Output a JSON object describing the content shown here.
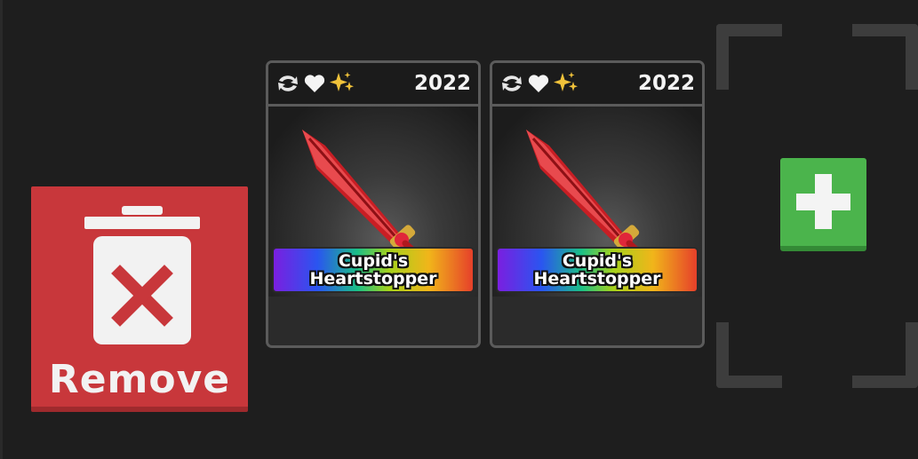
{
  "remove_button": {
    "label": "Remove",
    "icon": "trash-x-icon",
    "color": "#c8373b"
  },
  "cards": [
    {
      "badges": [
        "swap-icon",
        "heart-icon",
        "sparkles-icon"
      ],
      "year": "2022",
      "item_name_line1": "Cupid's",
      "item_name_line2": "Heartstopper",
      "rarity_colors": [
        "#7a1fe0",
        "#2a55f0",
        "#1bbf86",
        "#a6d21b",
        "#f1b51a",
        "#e6402a"
      ]
    },
    {
      "badges": [
        "swap-icon",
        "heart-icon",
        "sparkles-icon"
      ],
      "year": "2022",
      "item_name_line1": "Cupid's",
      "item_name_line2": "Heartstopper",
      "rarity_colors": [
        "#7a1fe0",
        "#2a55f0",
        "#1bbf86",
        "#a6d21b",
        "#f1b51a",
        "#e6402a"
      ]
    }
  ],
  "add_button": {
    "icon": "plus-icon",
    "color": "#4bb44c"
  }
}
